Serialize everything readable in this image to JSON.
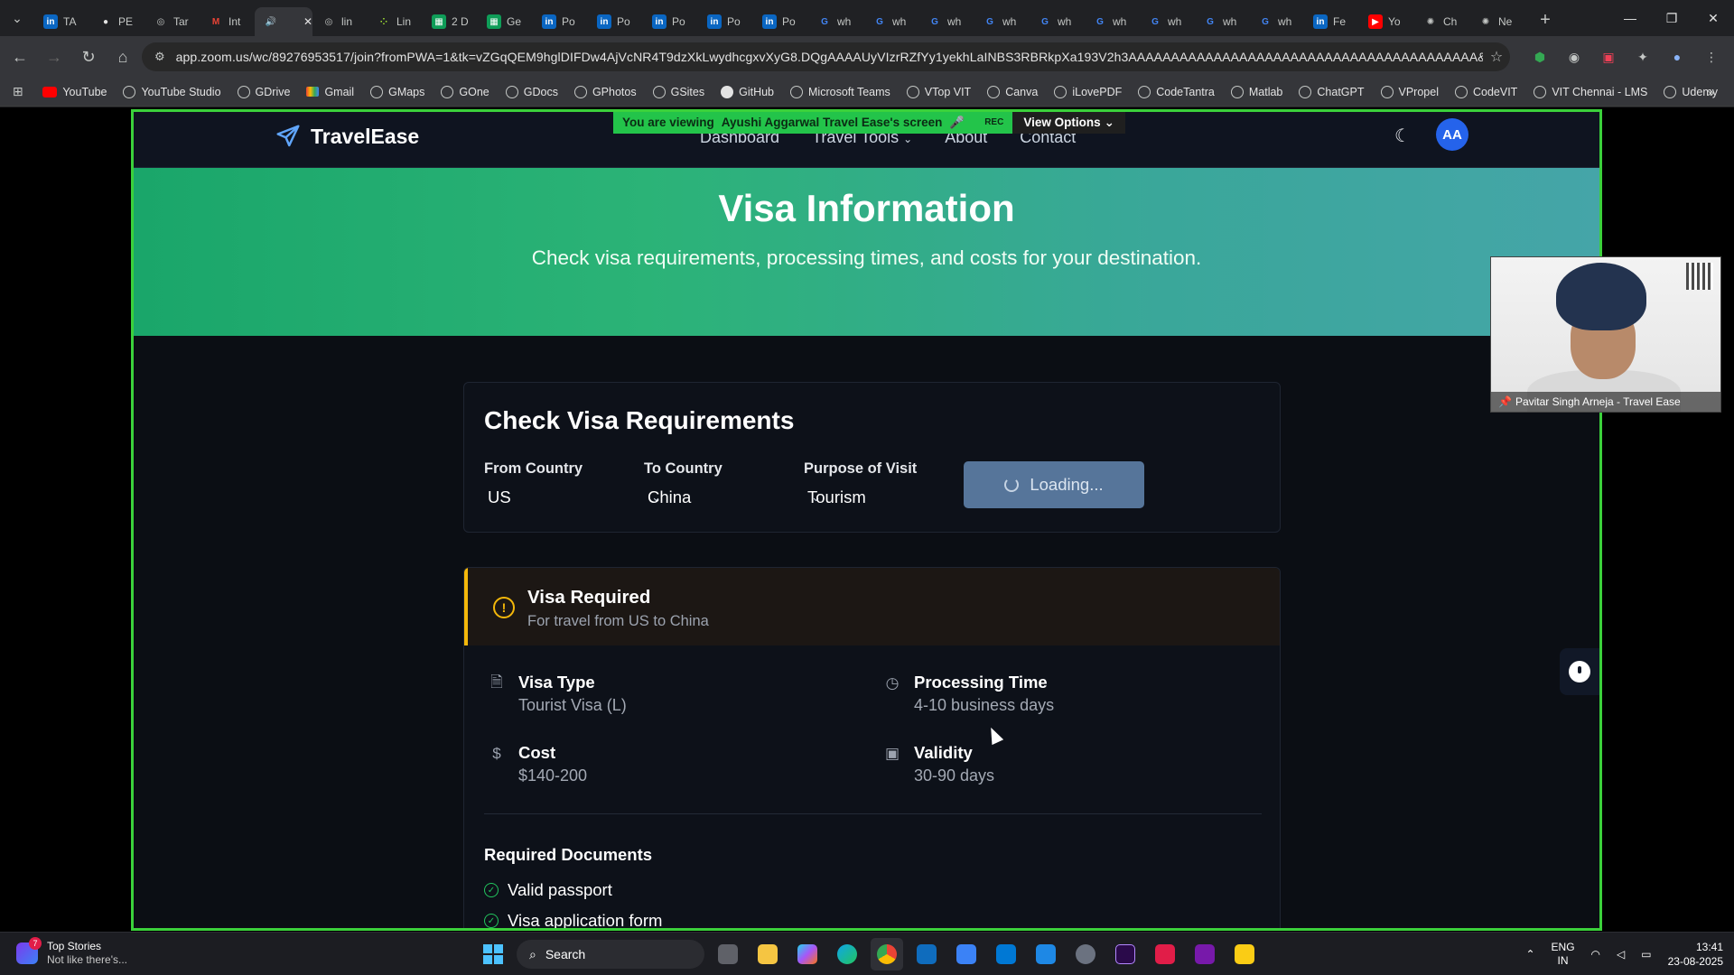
{
  "browser": {
    "tabs": [
      {
        "icon": "in",
        "label": "TA",
        "color": "#0a66c2"
      },
      {
        "icon": "gh",
        "label": "PE",
        "color": "#e3e3e3"
      },
      {
        "icon": "web",
        "label": "Tar",
        "color": "#c4c7c5"
      },
      {
        "icon": "M",
        "label": "Int",
        "color": "#ea4335"
      },
      {
        "icon": "audio",
        "label": "",
        "color": "#c4c7c5",
        "active": true
      },
      {
        "icon": "web",
        "label": "lin",
        "color": "#c4c7c5"
      },
      {
        "icon": "dots",
        "label": "Lin",
        "color": "#a3e635"
      },
      {
        "icon": "sheets",
        "label": "2 D",
        "color": "#0f9d58"
      },
      {
        "icon": "sheets",
        "label": "Ge",
        "color": "#0f9d58"
      },
      {
        "icon": "in",
        "label": "Po",
        "color": "#0a66c2"
      },
      {
        "icon": "in",
        "label": "Po",
        "color": "#0a66c2"
      },
      {
        "icon": "in",
        "label": "Po",
        "color": "#0a66c2"
      },
      {
        "icon": "in",
        "label": "Po",
        "color": "#0a66c2"
      },
      {
        "icon": "in",
        "label": "Po",
        "color": "#0a66c2"
      },
      {
        "icon": "G",
        "label": "wh",
        "color": "#4285f4"
      },
      {
        "icon": "G",
        "label": "wh",
        "color": "#4285f4"
      },
      {
        "icon": "G",
        "label": "wh",
        "color": "#4285f4"
      },
      {
        "icon": "G",
        "label": "wh",
        "color": "#4285f4"
      },
      {
        "icon": "G",
        "label": "wh",
        "color": "#4285f4"
      },
      {
        "icon": "G",
        "label": "wh",
        "color": "#4285f4"
      },
      {
        "icon": "G",
        "label": "wh",
        "color": "#4285f4"
      },
      {
        "icon": "G",
        "label": "wh",
        "color": "#4285f4"
      },
      {
        "icon": "G",
        "label": "wh",
        "color": "#4285f4"
      },
      {
        "icon": "in",
        "label": "Fe",
        "color": "#0a66c2"
      },
      {
        "icon": "yt",
        "label": "Yo",
        "color": "#ff0000"
      },
      {
        "icon": "gpt",
        "label": "Ch",
        "color": "#c4c7c5"
      },
      {
        "icon": "gpt",
        "label": "Ne",
        "color": "#c4c7c5"
      }
    ],
    "url": "app.zoom.us/wc/89276953517/join?fromPWA=1&tk=vZGqQEM9hglDIFDw4AjVcNR4T9dzXkLwydhcgxvXyG8.DQgAAAAUyVIzrRZfYy1yekhLaINBS3RBRkpXa193V2h3AAAAAAAAAAAAAAAAAAAAAAAAAAAAAAAAAAAAAAAAA&_x_zm_r...",
    "bookmarks": [
      {
        "label": "YouTube",
        "icon": "yt"
      },
      {
        "label": "YouTube Studio",
        "icon": "web"
      },
      {
        "label": "GDrive",
        "icon": "web"
      },
      {
        "label": "Gmail",
        "icon": "gm"
      },
      {
        "label": "GMaps",
        "icon": "web"
      },
      {
        "label": "GOne",
        "icon": "web"
      },
      {
        "label": "GDocs",
        "icon": "web"
      },
      {
        "label": "GPhotos",
        "icon": "web"
      },
      {
        "label": "GSites",
        "icon": "web"
      },
      {
        "label": "GitHub",
        "icon": "gh"
      },
      {
        "label": "Microsoft Teams",
        "icon": "web"
      },
      {
        "label": "VTop VIT",
        "icon": "web"
      },
      {
        "label": "Canva",
        "icon": "web"
      },
      {
        "label": "iLovePDF",
        "icon": "web"
      },
      {
        "label": "CodeTantra",
        "icon": "web"
      },
      {
        "label": "Matlab",
        "icon": "web"
      },
      {
        "label": "ChatGPT",
        "icon": "web"
      },
      {
        "label": "VPropel",
        "icon": "web"
      },
      {
        "label": "CodeVIT",
        "icon": "web"
      },
      {
        "label": "VIT Chennai - LMS",
        "icon": "web"
      },
      {
        "label": "Udemy",
        "icon": "web"
      }
    ]
  },
  "zoom": {
    "banner_prefix": "You are viewing",
    "banner_name": "Ayushi Aggarwal Travel Ease's screen",
    "rec": "REC",
    "view_options": "View Options",
    "video_name": "Pavitar Singh Arneja - Travel Ease"
  },
  "app": {
    "brand": "TravelEase",
    "nav": [
      "Dashboard",
      "Travel Tools",
      "About",
      "Contact"
    ],
    "avatar_initials": "AA",
    "hero": {
      "title": "Visa Information",
      "subtitle": "Check visa requirements, processing times, and costs for your destination."
    },
    "check": {
      "title": "Check Visa Requirements",
      "from_label": "From Country",
      "from_value": "US",
      "to_label": "To Country",
      "to_value": "China",
      "purpose_label": "Purpose of Visit",
      "purpose_value": "Tourism",
      "button": "Loading..."
    },
    "result": {
      "status_title": "Visa Required",
      "status_sub": "For travel from US to China",
      "visa_type_label": "Visa Type",
      "visa_type_value": "Tourist Visa (L)",
      "processing_label": "Processing Time",
      "processing_value": "4-10 business days",
      "cost_label": "Cost",
      "cost_value": "$140-200",
      "validity_label": "Validity",
      "validity_value": "30-90 days",
      "docs_title": "Required Documents",
      "docs": [
        "Valid passport",
        "Visa application form"
      ]
    },
    "colors": {
      "accent": "#22c55e",
      "warning": "#f5b80a",
      "button": "#56759a",
      "share_border": "#3bd13b"
    }
  },
  "taskbar": {
    "news_title": "Top Stories",
    "news_sub": "Not like there's...",
    "news_badge": "7",
    "search": "Search",
    "lang_top": "ENG",
    "lang_bottom": "IN",
    "time": "13:41",
    "date": "23-08-2025"
  }
}
